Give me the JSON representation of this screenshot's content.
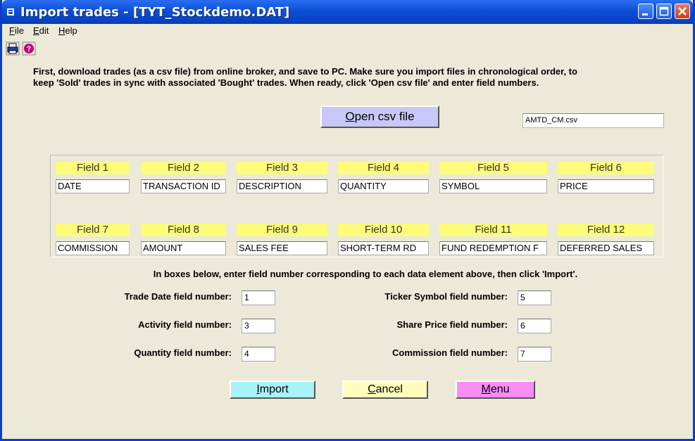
{
  "window": {
    "title": "Import trades - [TYT_Stockdemo.DAT]"
  },
  "menu": {
    "file": "File",
    "edit": "Edit",
    "help": "Help"
  },
  "instructions": {
    "line1": "First, download trades (as a csv file) from online broker, and save to PC.  Make sure you import files in chronological order, to",
    "line2": "keep 'Sold' trades in sync with associated 'Bought' trades.  When ready, click 'Open csv file' and enter field numbers."
  },
  "open_button": {
    "label": "Open csv file"
  },
  "file_name": "AMTD_CM.csv",
  "fields": [
    {
      "label": "Field 1",
      "value": "DATE"
    },
    {
      "label": "Field 2",
      "value": "TRANSACTION ID"
    },
    {
      "label": "Field 3",
      "value": "DESCRIPTION"
    },
    {
      "label": "Field 4",
      "value": "QUANTITY"
    },
    {
      "label": "Field 5",
      "value": "SYMBOL"
    },
    {
      "label": "Field 6",
      "value": "PRICE"
    },
    {
      "label": "Field 7",
      "value": "COMMISSION"
    },
    {
      "label": "Field 8",
      "value": "AMOUNT"
    },
    {
      "label": "Field 9",
      "value": "SALES FEE"
    },
    {
      "label": "Field 10",
      "value": "SHORT-TERM RD"
    },
    {
      "label": "Field 11",
      "value": "FUND REDEMPTION F"
    },
    {
      "label": "Field 12",
      "value": "DEFERRED SALES"
    }
  ],
  "hint": "In boxes below, enter field number corresponding to each data element above, then click 'Import'.",
  "mapping": {
    "trade_date": {
      "label": "Trade Date field number:",
      "value": "1"
    },
    "activity": {
      "label": "Activity field number:",
      "value": "3"
    },
    "quantity": {
      "label": "Quantity field number:",
      "value": "4"
    },
    "ticker": {
      "label": "Ticker Symbol field number:",
      "value": "5"
    },
    "share_price": {
      "label": "Share Price field number:",
      "value": "6"
    },
    "commission": {
      "label": "Commission field number:",
      "value": "7"
    }
  },
  "buttons": {
    "import": "Import",
    "cancel": "Cancel",
    "menu": "Menu"
  },
  "colors": {
    "titlebar": "#0b4fd6",
    "field_label_bg": "#fdfb7a",
    "open_button_bg": "#c8c8f8",
    "import_bg": "#a8f2f9",
    "cancel_bg": "#fffcbc",
    "menu_bg": "#f98cf5"
  }
}
